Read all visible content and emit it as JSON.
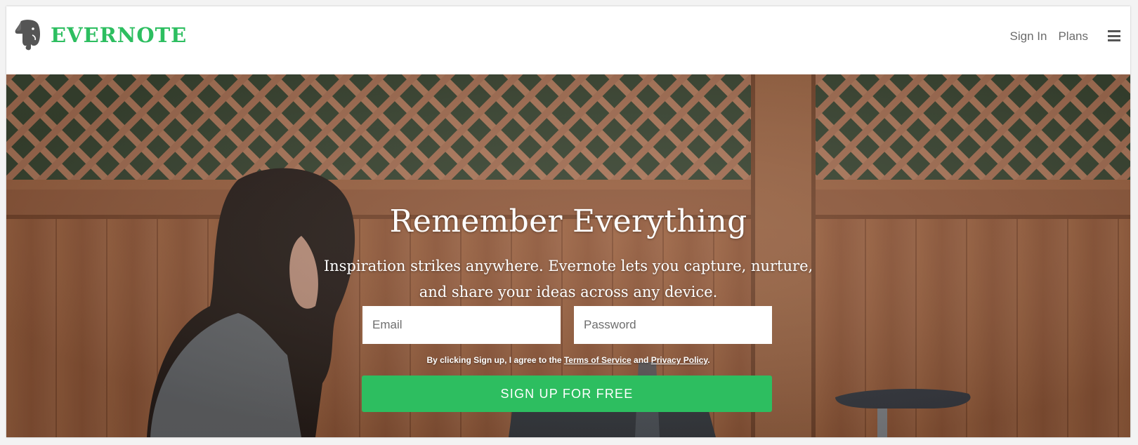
{
  "header": {
    "logo_text": "EVERNOTE",
    "logo_icon": "elephant-icon",
    "nav": {
      "sign_in": "Sign In",
      "plans": "Plans"
    },
    "menu_icon": "hamburger-menu-icon"
  },
  "hero": {
    "headline": "Remember Everything",
    "subhead": "Inspiration strikes anywhere. Evernote lets you capture, nurture, and share your ideas across any device.",
    "form": {
      "email_placeholder": "Email",
      "password_placeholder": "Password",
      "terms_prefix": "By clicking Sign up, I agree to the",
      "terms_link": "Terms of Service",
      "terms_and": "and",
      "privacy_link": "Privacy Policy",
      "terms_suffix": ".",
      "signup_label": "SIGN UP FOR FREE"
    }
  },
  "colors": {
    "brand_green": "#2dbe60",
    "nav_text": "#6b6b6b"
  }
}
